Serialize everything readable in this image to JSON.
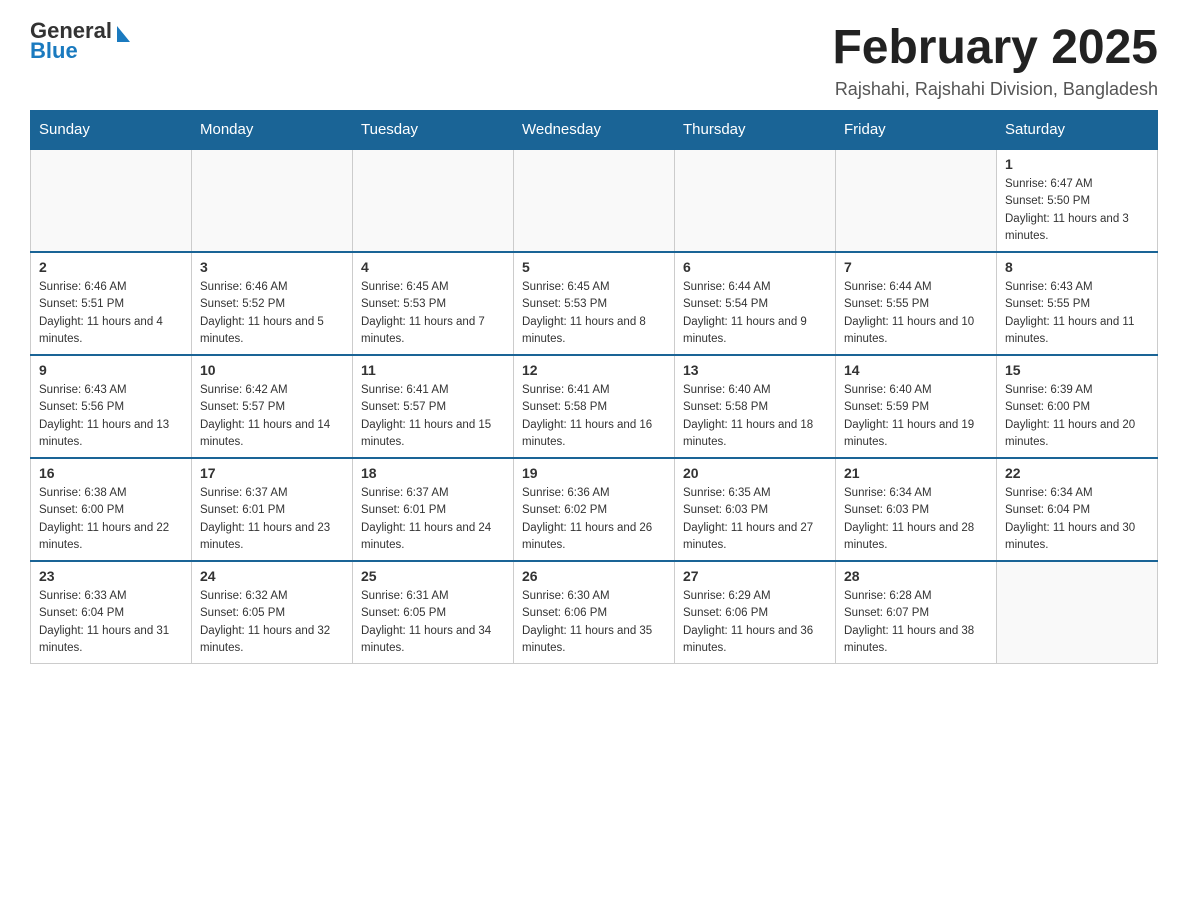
{
  "header": {
    "logo_general": "General",
    "logo_blue": "Blue",
    "title": "February 2025",
    "subtitle": "Rajshahi, Rajshahi Division, Bangladesh"
  },
  "calendar": {
    "days_of_week": [
      "Sunday",
      "Monday",
      "Tuesday",
      "Wednesday",
      "Thursday",
      "Friday",
      "Saturday"
    ],
    "weeks": [
      [
        {
          "day": "",
          "info": ""
        },
        {
          "day": "",
          "info": ""
        },
        {
          "day": "",
          "info": ""
        },
        {
          "day": "",
          "info": ""
        },
        {
          "day": "",
          "info": ""
        },
        {
          "day": "",
          "info": ""
        },
        {
          "day": "1",
          "info": "Sunrise: 6:47 AM\nSunset: 5:50 PM\nDaylight: 11 hours and 3 minutes."
        }
      ],
      [
        {
          "day": "2",
          "info": "Sunrise: 6:46 AM\nSunset: 5:51 PM\nDaylight: 11 hours and 4 minutes."
        },
        {
          "day": "3",
          "info": "Sunrise: 6:46 AM\nSunset: 5:52 PM\nDaylight: 11 hours and 5 minutes."
        },
        {
          "day": "4",
          "info": "Sunrise: 6:45 AM\nSunset: 5:53 PM\nDaylight: 11 hours and 7 minutes."
        },
        {
          "day": "5",
          "info": "Sunrise: 6:45 AM\nSunset: 5:53 PM\nDaylight: 11 hours and 8 minutes."
        },
        {
          "day": "6",
          "info": "Sunrise: 6:44 AM\nSunset: 5:54 PM\nDaylight: 11 hours and 9 minutes."
        },
        {
          "day": "7",
          "info": "Sunrise: 6:44 AM\nSunset: 5:55 PM\nDaylight: 11 hours and 10 minutes."
        },
        {
          "day": "8",
          "info": "Sunrise: 6:43 AM\nSunset: 5:55 PM\nDaylight: 11 hours and 11 minutes."
        }
      ],
      [
        {
          "day": "9",
          "info": "Sunrise: 6:43 AM\nSunset: 5:56 PM\nDaylight: 11 hours and 13 minutes."
        },
        {
          "day": "10",
          "info": "Sunrise: 6:42 AM\nSunset: 5:57 PM\nDaylight: 11 hours and 14 minutes."
        },
        {
          "day": "11",
          "info": "Sunrise: 6:41 AM\nSunset: 5:57 PM\nDaylight: 11 hours and 15 minutes."
        },
        {
          "day": "12",
          "info": "Sunrise: 6:41 AM\nSunset: 5:58 PM\nDaylight: 11 hours and 16 minutes."
        },
        {
          "day": "13",
          "info": "Sunrise: 6:40 AM\nSunset: 5:58 PM\nDaylight: 11 hours and 18 minutes."
        },
        {
          "day": "14",
          "info": "Sunrise: 6:40 AM\nSunset: 5:59 PM\nDaylight: 11 hours and 19 minutes."
        },
        {
          "day": "15",
          "info": "Sunrise: 6:39 AM\nSunset: 6:00 PM\nDaylight: 11 hours and 20 minutes."
        }
      ],
      [
        {
          "day": "16",
          "info": "Sunrise: 6:38 AM\nSunset: 6:00 PM\nDaylight: 11 hours and 22 minutes."
        },
        {
          "day": "17",
          "info": "Sunrise: 6:37 AM\nSunset: 6:01 PM\nDaylight: 11 hours and 23 minutes."
        },
        {
          "day": "18",
          "info": "Sunrise: 6:37 AM\nSunset: 6:01 PM\nDaylight: 11 hours and 24 minutes."
        },
        {
          "day": "19",
          "info": "Sunrise: 6:36 AM\nSunset: 6:02 PM\nDaylight: 11 hours and 26 minutes."
        },
        {
          "day": "20",
          "info": "Sunrise: 6:35 AM\nSunset: 6:03 PM\nDaylight: 11 hours and 27 minutes."
        },
        {
          "day": "21",
          "info": "Sunrise: 6:34 AM\nSunset: 6:03 PM\nDaylight: 11 hours and 28 minutes."
        },
        {
          "day": "22",
          "info": "Sunrise: 6:34 AM\nSunset: 6:04 PM\nDaylight: 11 hours and 30 minutes."
        }
      ],
      [
        {
          "day": "23",
          "info": "Sunrise: 6:33 AM\nSunset: 6:04 PM\nDaylight: 11 hours and 31 minutes."
        },
        {
          "day": "24",
          "info": "Sunrise: 6:32 AM\nSunset: 6:05 PM\nDaylight: 11 hours and 32 minutes."
        },
        {
          "day": "25",
          "info": "Sunrise: 6:31 AM\nSunset: 6:05 PM\nDaylight: 11 hours and 34 minutes."
        },
        {
          "day": "26",
          "info": "Sunrise: 6:30 AM\nSunset: 6:06 PM\nDaylight: 11 hours and 35 minutes."
        },
        {
          "day": "27",
          "info": "Sunrise: 6:29 AM\nSunset: 6:06 PM\nDaylight: 11 hours and 36 minutes."
        },
        {
          "day": "28",
          "info": "Sunrise: 6:28 AM\nSunset: 6:07 PM\nDaylight: 11 hours and 38 minutes."
        },
        {
          "day": "",
          "info": ""
        }
      ]
    ]
  }
}
